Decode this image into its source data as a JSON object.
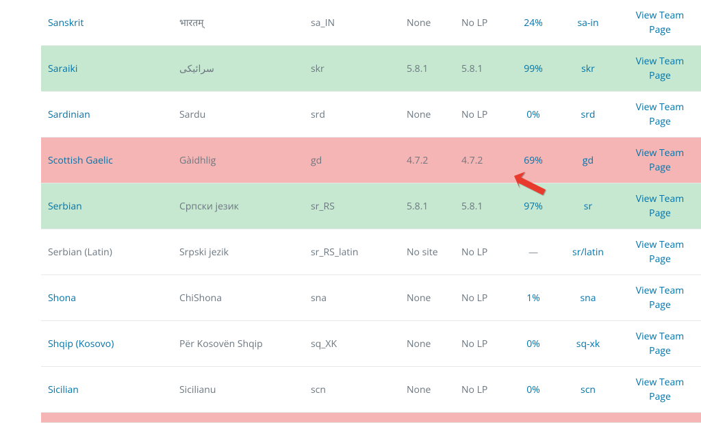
{
  "arrow_color": "#e83a2e",
  "view_team_label": "View Team Page",
  "rows": [
    {
      "bg": "white",
      "language": "Sanskrit",
      "language_link": true,
      "native": "भारतम्",
      "locale": "sa_IN",
      "version": "None",
      "lp": "No LP",
      "percent": "24%",
      "percent_link": true,
      "code": "sa-in",
      "code_link": true
    },
    {
      "bg": "green",
      "language": "Saraiki",
      "language_link": true,
      "native": "سرائیکی",
      "locale": "skr",
      "version": "5.8.1",
      "lp": "5.8.1",
      "percent": "99%",
      "percent_link": true,
      "code": "skr",
      "code_link": true
    },
    {
      "bg": "white",
      "language": "Sardinian",
      "language_link": true,
      "native": "Sardu",
      "locale": "srd",
      "version": "None",
      "lp": "No LP",
      "percent": "0%",
      "percent_link": true,
      "code": "srd",
      "code_link": true
    },
    {
      "bg": "pink",
      "language": "Scottish Gaelic",
      "language_link": true,
      "native": "Gàidhlig",
      "locale": "gd",
      "version": "4.7.2",
      "lp": "4.7.2",
      "percent": "69%",
      "percent_link": true,
      "code": "gd",
      "code_link": true
    },
    {
      "bg": "green",
      "language": "Serbian",
      "language_link": true,
      "native": "Српски језик",
      "locale": "sr_RS",
      "version": "5.8.1",
      "lp": "5.8.1",
      "percent": "97%",
      "percent_link": true,
      "code": "sr",
      "code_link": true
    },
    {
      "bg": "white",
      "language": "Serbian (Latin)",
      "language_link": false,
      "native": "Srpski jezik",
      "locale": "sr_RS_latin",
      "version": "No site",
      "lp": "No LP",
      "percent": "—",
      "percent_link": false,
      "code": "sr/latin",
      "code_link": true
    },
    {
      "bg": "white",
      "language": "Shona",
      "language_link": true,
      "native": "ChiShona",
      "locale": "sna",
      "version": "None",
      "lp": "No LP",
      "percent": "1%",
      "percent_link": true,
      "code": "sna",
      "code_link": true
    },
    {
      "bg": "white",
      "language": "Shqip (Kosovo)",
      "language_link": true,
      "native": "Për Kosovën Shqip",
      "locale": "sq_XK",
      "version": "None",
      "lp": "No LP",
      "percent": "0%",
      "percent_link": true,
      "code": "sq-xk",
      "code_link": true
    },
    {
      "bg": "white",
      "language": "Sicilian",
      "language_link": true,
      "native": "Sicilianu",
      "locale": "scn",
      "version": "None",
      "lp": "No LP",
      "percent": "0%",
      "percent_link": true,
      "code": "scn",
      "code_link": true
    }
  ]
}
